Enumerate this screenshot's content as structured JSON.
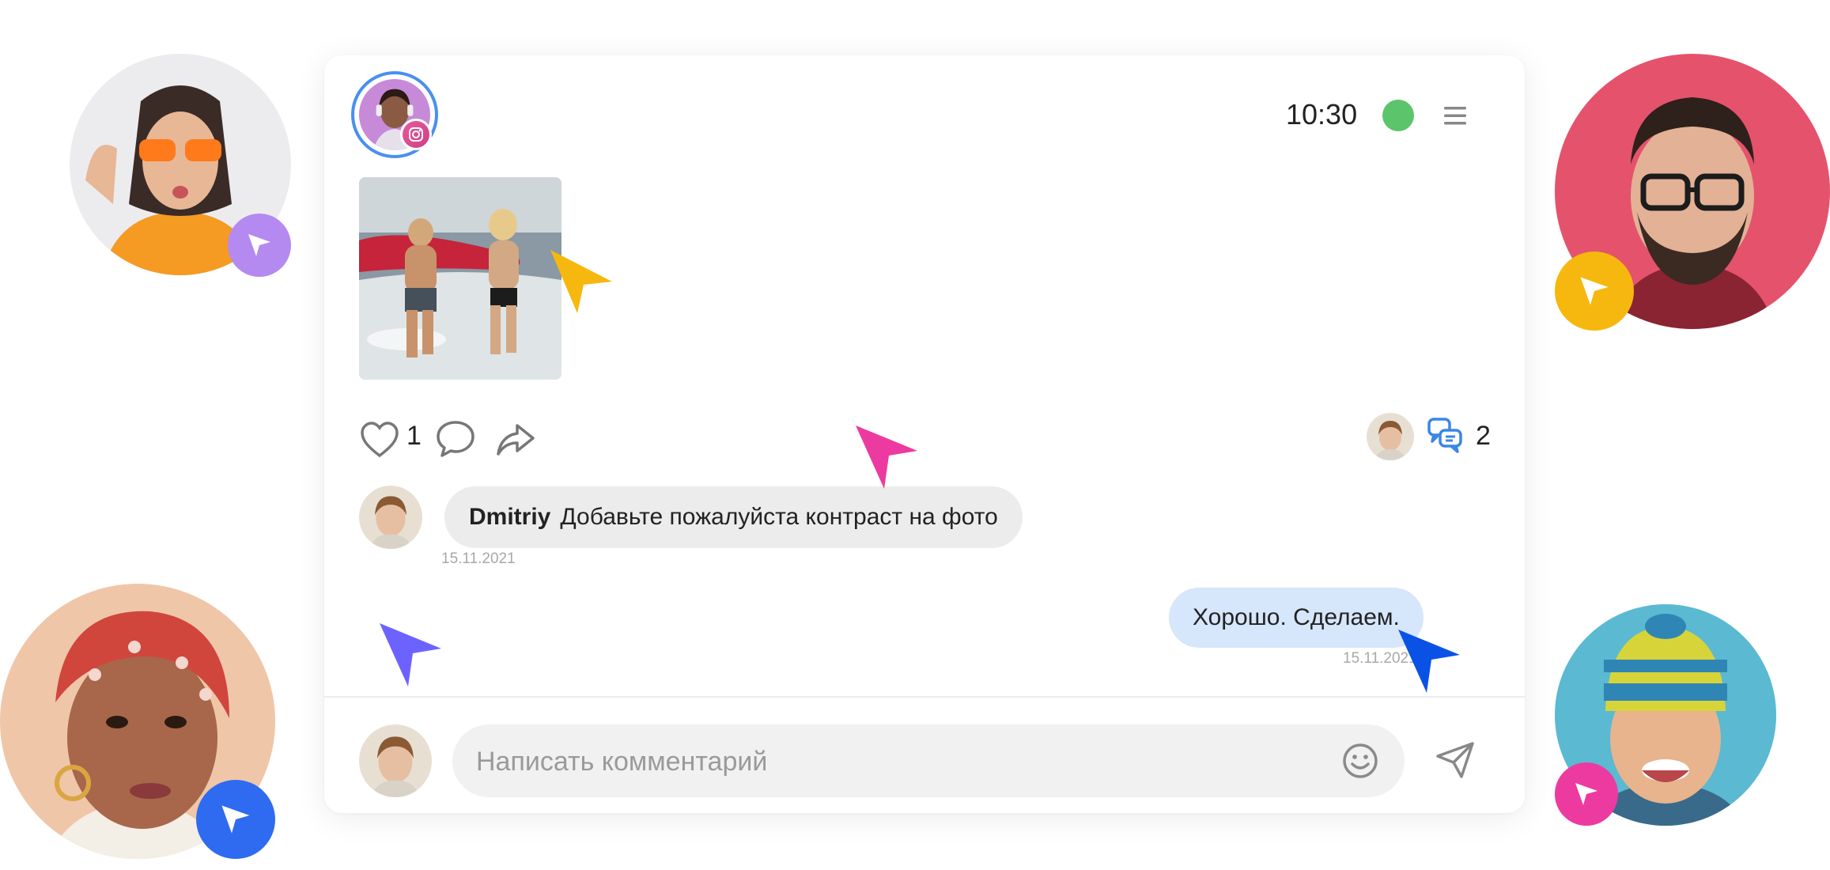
{
  "header": {
    "time": "10:30",
    "status_color": "#5cc46a",
    "menu_icon": "hamburger-menu-icon",
    "story_badge_icon": "instagram-icon"
  },
  "post": {
    "photo": "beach-surfers-photo",
    "likes": "1",
    "comments_participants": "2"
  },
  "comments": [
    {
      "author": "Dmitriy",
      "text": "Добавьте пожалуйста контраст на фото",
      "date": "15.11.2021"
    },
    {
      "text": "Хорошо. Сделаем.",
      "date": "15.11.2021"
    }
  ],
  "composer": {
    "placeholder": "Написать комментарий",
    "emoji_icon": "smile-icon",
    "send_icon": "paper-plane-icon"
  },
  "colors": {
    "accent_blue": "#4a8ff0",
    "bubble_out": "#d6e6fb",
    "bubble_in": "#ececec",
    "cursor_purple": "#b48af0",
    "cursor_yellow": "#f6b80e",
    "cursor_blue": "#2f6bf0",
    "cursor_pink": "#ec3aa0",
    "cursor_violet": "#6c63ff",
    "cursor_darkblue": "#0a52e6"
  }
}
